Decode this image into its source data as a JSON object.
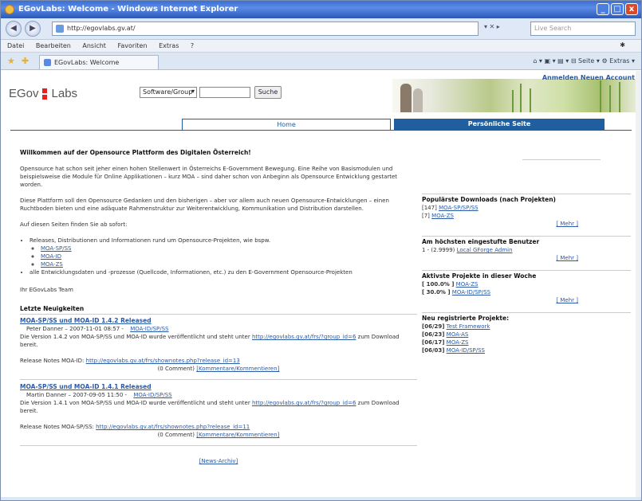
{
  "window": {
    "title": "EGovLabs: Welcome - Windows Internet Explorer",
    "min": "_",
    "max": "□",
    "close": "x"
  },
  "address": {
    "url": "http://egovlabs.gv.at/",
    "tools": "▾ ✕ ▸",
    "search_placeholder": "Live Search"
  },
  "menu": [
    "Datei",
    "Bearbeiten",
    "Ansicht",
    "Favoriten",
    "Extras",
    "?"
  ],
  "menu_right": "✱",
  "tab": {
    "label": "EGovLabs: Welcome"
  },
  "command_bar": "⌂ ▾ ▣ ▾  ▤ ▾  ⊟ Seite ▾  ⚙ Extras ▾",
  "header": {
    "logo_left": "EGov",
    "logo_right": "Labs",
    "group_select": "Software/Group",
    "search_button": "Suche",
    "account_link": "Anmelden Neuen Account"
  },
  "navtabs": {
    "home": "Home",
    "personal": "Persönliche Seite"
  },
  "main": {
    "heading": "Willkommen auf der Opensource Plattform des Digitalen Österreich!",
    "p1": "Opensource hat schon seit jeher einen hohen Stellenwert in Österreichs E-Government Bewegung. Eine Reihe von Basismodulen und beispielsweise die Module für Online Applikationen – kurz MOA – sind daher schon von Anbeginn als Opensource Entwicklung gestartet worden.",
    "p2": "Diese Plattform soll den Opensource Gedanken und den bisherigen – aber vor allem auch neuen Opensource-Entwicklungen – einen Ruchtboden bieten und eine adäquate Rahmenstruktur zur Weiterentwicklung, Kommunikation und Distribution darstellen.",
    "p3": "Auf diesen Seiten finden Sie ab sofort:",
    "list1": "Releases, Distributionen und Informationen rund um Opensource-Projekten, wie bspw.",
    "sublist": [
      "MOA-SP/SS",
      "MOA-ID",
      "MOA-ZS"
    ],
    "list2": "alle Entwicklungsdaten und -prozesse (Quellcode, Informationen, etc.) zu den E-Government Opensource-Projekten",
    "signoff": "Ihr EGovLabs Team",
    "news_heading": "Letzte Neuigkeiten",
    "news": [
      {
        "title": "MOA-SP/SS und MOA-ID 1.4.2 Released",
        "author": "Peter Danner – 2007-11-01 08:57",
        "project": "MOA-ID/SP/SS",
        "body": "Die Version 1.4.2 von MOA-SP/SS und MOA-ID wurde veröffentlicht und steht unter",
        "link": "http://egovlabs.gv.at/frs/?group_id=6",
        "body_end": "zum Download bereit.",
        "notes_label": "Release Notes MOA-ID:",
        "notes_link": "http://egovlabs.gv.at/frs/shownotes.php?release_id=13",
        "comments": "(0 Comment)",
        "comment_link": "[Kommentare/Kommentieren]"
      },
      {
        "title": "MOA-SP/SS und MOA-ID 1.4.1 Released",
        "author": "Martin Danner – 2007-09-05 11:50",
        "project": "MOA-ID/SP/SS",
        "body": "Die Version 1.4.1 von MOA-SP/SS und MOA-ID wurde veröffentlicht und steht unter",
        "link": "http://egovlabs.gv.at/frs/?group_id=6",
        "body_end": "zum Download bereit.",
        "notes_label": "Release Notes MOA-SP/SS:",
        "notes_link": "http://egovlabs.gv.at/frs/shownotes.php?release_id=11",
        "comments": "(0 Comment)",
        "comment_link": "[Kommentare/Kommentieren]"
      }
    ],
    "older_link": "[News-Archiv]"
  },
  "side": {
    "downloads_heading": "Populärste Downloads (nach Projekten)",
    "downloads": [
      {
        "count": "[147]",
        "name": "MOA-SP/SP/SS"
      },
      {
        "count": "[7]",
        "name": "MOA-ZS"
      }
    ],
    "more1": "[ Mehr ]",
    "users_heading": "Am höchsten eingestufte Benutzer",
    "users": [
      {
        "rank": "1 - (2.9999)",
        "name": "Local GForge Admin"
      }
    ],
    "more2": "[ Mehr ]",
    "active_heading": "Aktivste Projekte in dieser Woche",
    "active": [
      {
        "pct": "[ 100.0% ]",
        "name": "MOA-ZS"
      },
      {
        "pct": "[ 30.0% ]",
        "name": "MOA-ID/SP/SS"
      }
    ],
    "more3": "[ Mehr ]",
    "new_heading": "Neu registrierte Projekte:",
    "new": [
      {
        "date": "[06/29]",
        "name": "Test Framework"
      },
      {
        "date": "[06/23]",
        "name": "MOA-AS"
      },
      {
        "date": "[06/17]",
        "name": "MOA-ZS"
      },
      {
        "date": "[06/03]",
        "name": "MOA-ID/SP/SS"
      }
    ]
  }
}
